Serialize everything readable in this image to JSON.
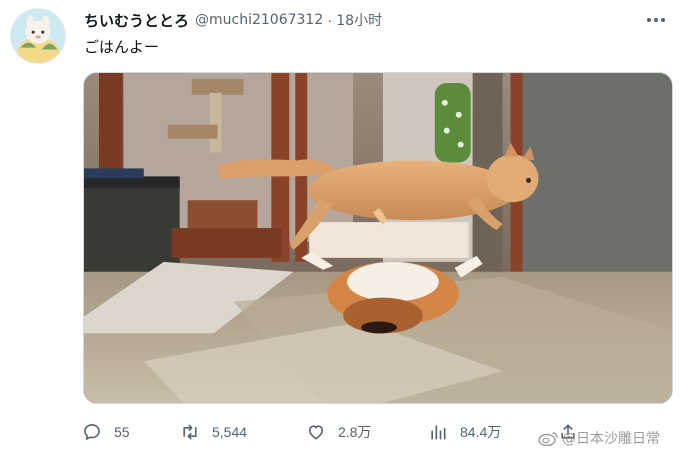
{
  "tweet": {
    "display_name": "ちいむうととろ",
    "handle": "@muchi21067312",
    "separator": "·",
    "time": "18小时",
    "text": "ごはんよー"
  },
  "media": {
    "description_icon": "photo-cat-jumping-over-corgi"
  },
  "actions": {
    "reply_count": "55",
    "retweet_count": "5,544",
    "like_count": "2.8万",
    "views_count": "84.4万"
  },
  "watermark": {
    "text": "@日本沙雕日常",
    "icon": "weibo-logo"
  },
  "colors": {
    "text_primary": "#0f1419",
    "text_secondary": "#536471",
    "border": "#cfd9de"
  }
}
